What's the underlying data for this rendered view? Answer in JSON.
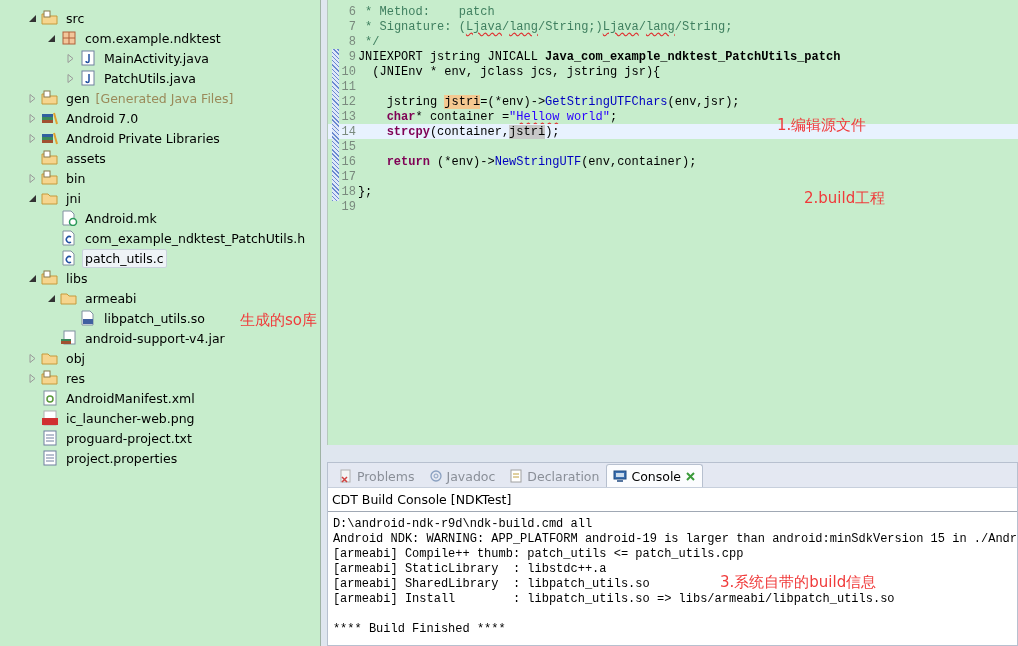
{
  "tree": [
    {
      "label": "src",
      "kind": "source-folder",
      "expanded": true,
      "selected": false,
      "children": [
        {
          "label": "com.example.ndktest",
          "kind": "package",
          "expanded": true,
          "selected": false,
          "children": [
            {
              "label": "MainActivity.java",
              "kind": "java-file",
              "expanded": false,
              "selected": false
            },
            {
              "label": "PatchUtils.java",
              "kind": "java-file",
              "expanded": false,
              "selected": false
            }
          ]
        }
      ]
    },
    {
      "label": "gen",
      "decoration": "[Generated Java Files]",
      "kind": "source-folder",
      "expanded": false,
      "selected": false
    },
    {
      "label": "Android 7.0",
      "kind": "library",
      "expanded": false,
      "selected": false
    },
    {
      "label": "Android Private Libraries",
      "kind": "library",
      "expanded": false,
      "selected": false
    },
    {
      "label": "assets",
      "kind": "res-folder",
      "selected": false
    },
    {
      "label": "bin",
      "kind": "res-folder",
      "expanded": false,
      "selected": false
    },
    {
      "label": "jni",
      "kind": "folder",
      "expanded": true,
      "selected": false,
      "children": [
        {
          "label": "Android.mk",
          "kind": "mk-file",
          "selected": false
        },
        {
          "label": "com_example_ndktest_PatchUtils.h",
          "kind": "c-file",
          "selected": false
        },
        {
          "label": "patch_utils.c",
          "kind": "c-file",
          "selected": true
        }
      ]
    },
    {
      "label": "libs",
      "kind": "res-folder",
      "expanded": true,
      "selected": false,
      "children": [
        {
          "label": "armeabi",
          "kind": "folder",
          "expanded": true,
          "selected": false,
          "children": [
            {
              "label": "libpatch_utils.so",
              "kind": "binary-file",
              "selected": false
            }
          ]
        },
        {
          "label": "android-support-v4.jar",
          "kind": "jar-file",
          "selected": false
        }
      ]
    },
    {
      "label": "obj",
      "kind": "folder",
      "expanded": false,
      "selected": false
    },
    {
      "label": "res",
      "kind": "res-folder",
      "expanded": false,
      "selected": false
    },
    {
      "label": "AndroidManifest.xml",
      "kind": "xml-file",
      "selected": false
    },
    {
      "label": "ic_launcher-web.png",
      "kind": "png-file",
      "selected": false
    },
    {
      "label": "proguard-project.txt",
      "kind": "text-file",
      "selected": false
    },
    {
      "label": "project.properties",
      "kind": "text-file",
      "selected": false
    }
  ],
  "tree_annotation": "生成的so库",
  "editor": {
    "lines": [
      {
        "number": "6",
        "current": false,
        "segments": [
          {
            "text": " * Method:    patch",
            "kind": "comment"
          }
        ]
      },
      {
        "number": "7",
        "current": false,
        "segments": [
          {
            "text": " * Signature: (",
            "kind": "comment"
          },
          {
            "text": "Ljava",
            "kind": "comment",
            "squiggle": true
          },
          {
            "text": "/",
            "kind": "comment"
          },
          {
            "text": "lang",
            "kind": "comment",
            "squiggle": true
          },
          {
            "text": "/String;)",
            "kind": "comment"
          },
          {
            "text": "Ljava",
            "kind": "comment",
            "squiggle": true
          },
          {
            "text": "/",
            "kind": "comment"
          },
          {
            "text": "lang",
            "kind": "comment",
            "squiggle": true
          },
          {
            "text": "/String;",
            "kind": "comment"
          }
        ]
      },
      {
        "number": "8",
        "current": false,
        "segments": [
          {
            "text": " */",
            "kind": "comment"
          }
        ]
      },
      {
        "number": "9",
        "current": false,
        "segments": [
          {
            "text": "JNIEXPORT jstring JNICALL ",
            "kind": "plain"
          },
          {
            "text": "Java_com_example_ndktest_PatchUtils_patch",
            "kind": "bold"
          }
        ]
      },
      {
        "number": "10",
        "current": false,
        "segments": [
          {
            "text": "  (JNIEnv * env, jclass jcs, jstring jsr){",
            "kind": "plain"
          }
        ]
      },
      {
        "number": "11",
        "current": false
      },
      {
        "number": "12",
        "current": false,
        "indented": true,
        "segments": [
          {
            "text": "jstring ",
            "kind": "plain"
          },
          {
            "text": "jstri",
            "kind": "occurrence"
          },
          {
            "text": "=(*env)->",
            "kind": "plain"
          },
          {
            "text": "GetStringUTFChars",
            "kind": "function"
          },
          {
            "text": "(env,jsr);",
            "kind": "plain"
          }
        ]
      },
      {
        "number": "13",
        "current": false,
        "indented": true,
        "segments": [
          {
            "text": "char",
            "kind": "keyword"
          },
          {
            "text": "* container =",
            "kind": "plain"
          },
          {
            "text": "\"",
            "kind": "string"
          },
          {
            "text": "Hellow",
            "kind": "string",
            "squiggle": true
          },
          {
            "text": " world\"",
            "kind": "string"
          },
          {
            "text": ";",
            "kind": "plain"
          }
        ]
      },
      {
        "number": "14",
        "current": true,
        "indented": true,
        "segments": [
          {
            "text": "strcpy",
            "kind": "keyword"
          },
          {
            "text": "(container,",
            "kind": "plain"
          },
          {
            "text": "jstri",
            "kind": "selection"
          },
          {
            "text": ");",
            "kind": "plain"
          }
        ]
      },
      {
        "number": "15",
        "current": false
      },
      {
        "number": "16",
        "current": false,
        "indented": true,
        "segments": [
          {
            "text": "return",
            "kind": "keyword"
          },
          {
            "text": " (*env)->",
            "kind": "plain"
          },
          {
            "text": "NewStringUTF",
            "kind": "function"
          },
          {
            "text": "(env,container);",
            "kind": "plain"
          }
        ]
      },
      {
        "number": "17",
        "current": false
      },
      {
        "number": "18",
        "current": false,
        "segments": [
          {
            "text": "};",
            "kind": "plain"
          }
        ]
      },
      {
        "number": "19",
        "current": false
      }
    ],
    "annotations": [
      "1.编辑源文件",
      "2.build工程"
    ]
  },
  "console": {
    "tabs": [
      {
        "label": "Problems",
        "kind": "problems",
        "selected": false
      },
      {
        "label": "Javadoc",
        "kind": "javadoc",
        "selected": false
      },
      {
        "label": "Declaration",
        "kind": "declaration",
        "selected": false
      },
      {
        "label": "Console",
        "kind": "console",
        "selected": true,
        "closable": true
      }
    ],
    "title": "CDT Build Console [NDKTest]",
    "lines": [
      "D:\\android-ndk-r9d\\ndk-build.cmd all",
      "Android NDK: WARNING: APP_PLATFORM android-19 is larger than android:minSdkVersion 15 in ./Andr",
      "[armeabi] Compile++ thumb: patch_utils <= patch_utils.cpp",
      "[armeabi] StaticLibrary  : libstdc++.a",
      "[armeabi] SharedLibrary  : libpatch_utils.so",
      "[armeabi] Install        : libpatch_utils.so => libs/armeabi/libpatch_utils.so"
    ],
    "footer": "**** Build Finished ****",
    "annotation": "3.系统自带的build信息"
  }
}
